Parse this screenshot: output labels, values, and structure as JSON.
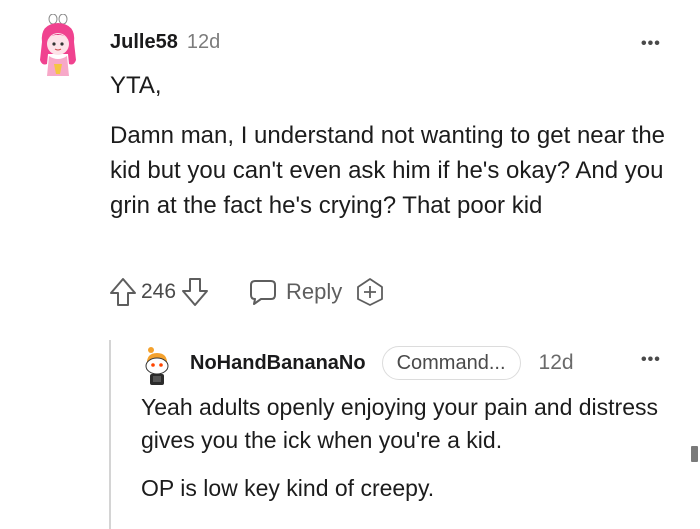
{
  "comment": {
    "username": "Julle58",
    "age": "12d",
    "paragraphs": [
      "YTA,",
      "Damn man, I understand not wanting to get near the kid but you can't even ask him if he's okay? And you grin at the fact he's crying? That poor kid"
    ],
    "score": "246",
    "reply_label": "Reply"
  },
  "reply": {
    "username": "NoHandBananaNo",
    "flair": "Command...",
    "age": "12d",
    "paragraphs": [
      "Yeah adults openly enjoying your pain and distress gives you the ick when you're a kid.",
      "OP is low key kind of creepy."
    ]
  },
  "icons": {
    "upvote": "arrow-up-outline-icon",
    "downvote": "arrow-down-outline-icon",
    "reply": "speech-bubble-icon",
    "award": "award-plus-icon",
    "more": "ellipsis-icon"
  },
  "colors": {
    "text": "#1c1c1c",
    "muted": "#7c7c7c",
    "icon": "#5e5e5e",
    "avatar_pink": "#f0428f",
    "flair_border": "#dcdcdc"
  }
}
